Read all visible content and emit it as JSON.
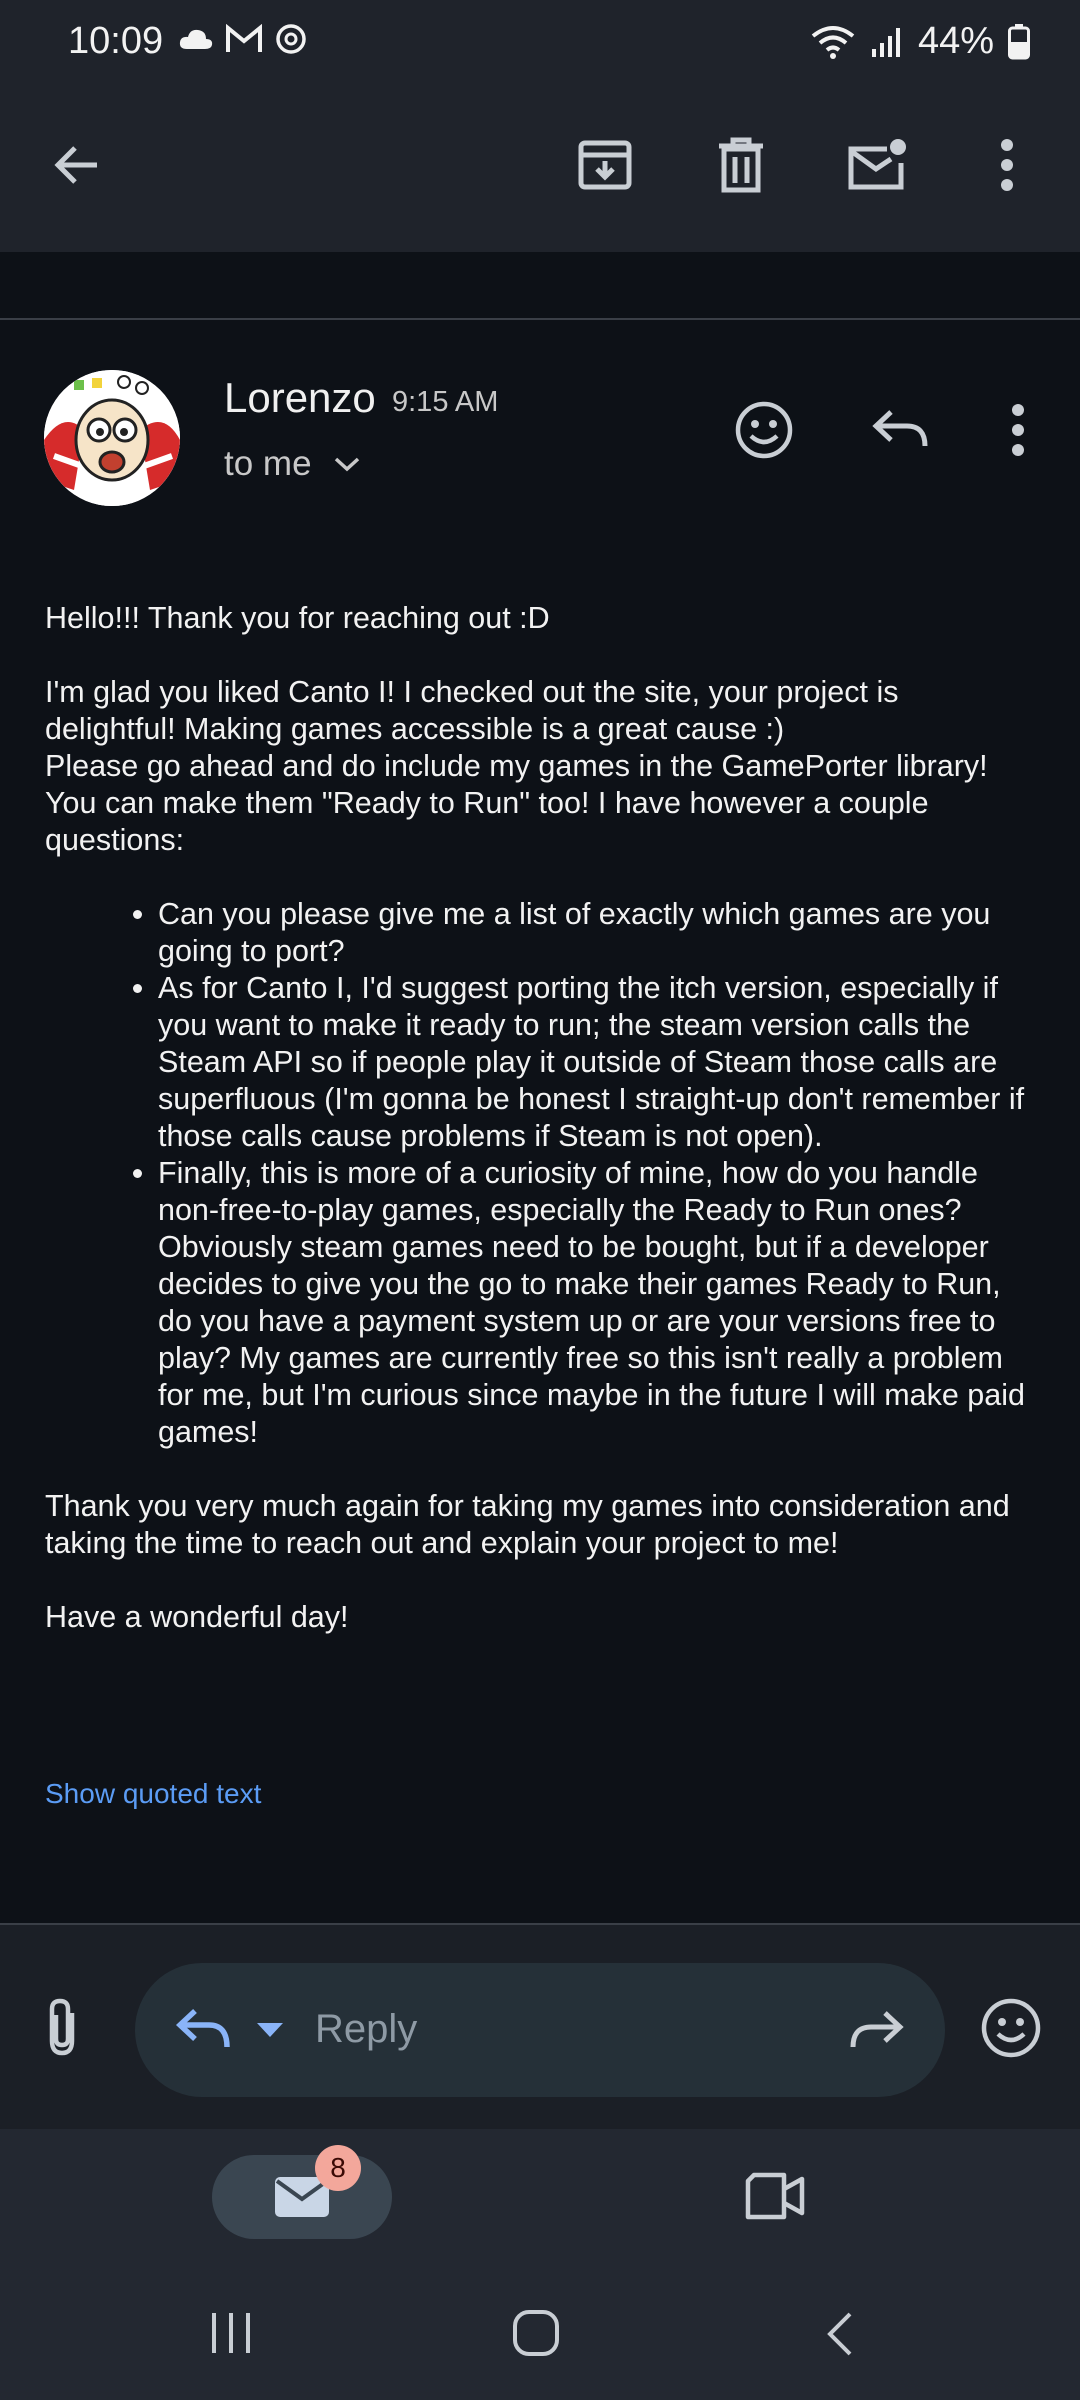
{
  "status": {
    "time": "10:09",
    "battery": "44%",
    "left_icons": [
      "cloud-icon",
      "gmail-icon",
      "sync-icon"
    ],
    "right_icons": [
      "wifi-icon",
      "signal-icon",
      "battery-icon"
    ]
  },
  "toolbar": {
    "icons": [
      "back-arrow-icon",
      "archive-icon",
      "delete-icon",
      "mark-unread-icon",
      "more-vert-icon"
    ]
  },
  "email": {
    "sender": "Lorenzo",
    "time": "9:15 AM",
    "recipient": "to me",
    "greeting": "Hello!!! Thank you for reaching out :D",
    "para1": "I'm glad you liked Canto I! I checked out the site, your project is delightful! Making games accessible is a great cause :)",
    "para1b": "Please go ahead and do include my games in the GamePorter library! You can make them \"Ready to Run\" too! I have however a couple questions:",
    "bullets": [
      "Can you please give me a list of exactly which games are you going to port?",
      "As for Canto I, I'd suggest porting the itch version, especially if you want to make it ready to run; the steam version calls the Steam API so if people play it outside of Steam those calls are superfluous (I'm gonna be honest I straight-up don't remember if those calls cause problems if Steam is not open).",
      "Finally, this is more of a curiosity of mine, how do you handle non-free-to-play games, especially the Ready to Run ones? Obviously steam games need to be bought, but if a developer decides to give you the go to make their games Ready to Run, do you have a payment system up or are your versions free to play? My games are currently free so this isn't really a problem for me, but I'm curious since maybe in the future I will make paid games!"
    ],
    "para2": "Thank you very much again for taking my games into consideration and taking the time to reach out and explain your project to me!",
    "signoff": "Have a wonderful day!",
    "show_quoted": "Show quoted text"
  },
  "reply": {
    "label": "Reply"
  },
  "nav": {
    "mail_badge": "8"
  },
  "colors": {
    "background": "#0d1117",
    "link": "#5b9cf5",
    "accent": "#8ab4f8",
    "badge": "#f3a79b"
  }
}
